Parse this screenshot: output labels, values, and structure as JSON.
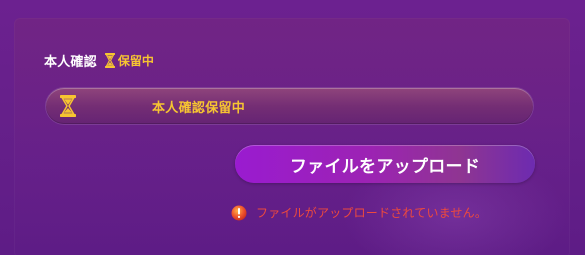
{
  "verification": {
    "title": "本人確認",
    "header_status": {
      "icon": "hourglass-icon",
      "label": "保留中"
    },
    "status_bar": {
      "icon": "hourglass-icon",
      "label": "本人確認保留中"
    },
    "upload_button": {
      "label": "ファイルをアップロード"
    },
    "warning": {
      "icon": "warning-circle-icon",
      "message": "ファイルがアップロードされていません。"
    }
  },
  "colors": {
    "background": "#66208a",
    "status_gold": "#f7c531",
    "warning_red": "#ee4a3d",
    "button_start": "#9a1bd0",
    "button_end": "#6d2bb0"
  }
}
